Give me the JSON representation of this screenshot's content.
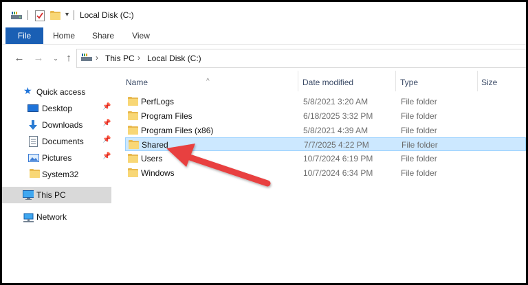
{
  "window": {
    "title": "Local Disk (C:)"
  },
  "ribbon": {
    "tabs": [
      "File",
      "Home",
      "Share",
      "View"
    ]
  },
  "address": {
    "crumbs": [
      "This PC",
      "Local Disk (C:)"
    ]
  },
  "nav": {
    "quick_access": "Quick access",
    "items": [
      "Desktop",
      "Downloads",
      "Documents",
      "Pictures",
      "System32"
    ],
    "this_pc": "This PC",
    "network": "Network"
  },
  "columns": {
    "name": "Name",
    "date": "Date modified",
    "type": "Type",
    "size": "Size"
  },
  "files": [
    {
      "name": "PerfLogs",
      "date": "5/8/2021 3:20 AM",
      "type": "File folder"
    },
    {
      "name": "Program Files",
      "date": "6/18/2025 3:32 PM",
      "type": "File folder"
    },
    {
      "name": "Program Files (x86)",
      "date": "5/8/2021 4:39 AM",
      "type": "File folder"
    },
    {
      "name": "Shared",
      "date": "7/7/2025 4:22 PM",
      "type": "File folder"
    },
    {
      "name": "Users",
      "date": "10/7/2024 6:19 PM",
      "type": "File folder"
    },
    {
      "name": "Windows",
      "date": "10/7/2024 6:34 PM",
      "type": "File folder"
    }
  ],
  "colors": {
    "accent": "#1a5fb4",
    "selection": "#cce8ff",
    "annotation_arrow": "#e8403f"
  }
}
